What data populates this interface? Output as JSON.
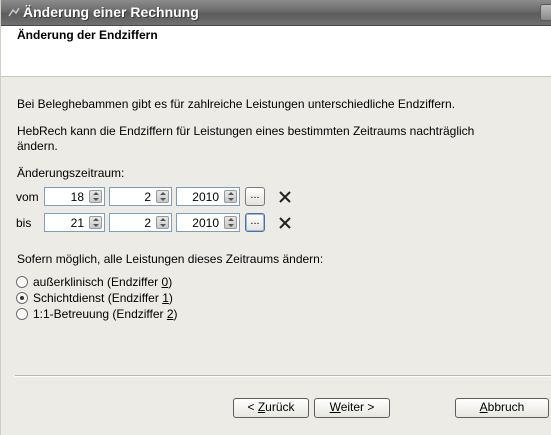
{
  "window": {
    "title": "Änderung einer Rechnung"
  },
  "header": {
    "title": "Änderung der Endziffern"
  },
  "main": {
    "intro_line1": "Bei Beleghebammen gibt es für zahlreiche Leistungen unterschiedliche Endziffern.",
    "intro_line2a": "HebRech kann die Endziffern für Leistungen eines bestimmten Zeitraums nachträglich",
    "intro_line2b": "ändern.",
    "period_label": "Änderungszeitraum:",
    "from": {
      "label": "vom",
      "day": "18",
      "month": "2",
      "year": "2010",
      "picker_label": "..."
    },
    "to": {
      "label": "bis",
      "day": "21",
      "month": "2",
      "year": "2010",
      "picker_label": "..."
    },
    "options_label": "Sofern möglich, alle Leistungen dieses Zeitraums ändern:",
    "options": [
      {
        "text": "außerklinisch (Endziffer ",
        "digit": "0",
        "end": ")",
        "selected": false
      },
      {
        "text": "Schichtdienst (Endziffer ",
        "digit": "1",
        "end": ")",
        "selected": true
      },
      {
        "text": "1:1-Betreuung (Endziffer ",
        "digit": "2",
        "end": ")",
        "selected": false
      }
    ]
  },
  "footer": {
    "back": {
      "prefix": "< ",
      "mnemonic": "Z",
      "rest": "urück"
    },
    "next": {
      "mnemonic": "W",
      "rest": "eiter >"
    },
    "cancel": {
      "mnemonic": "A",
      "rest": "bbruch"
    }
  },
  "icons": {
    "window": "window-app-icon",
    "clear": "clear-x-icon",
    "spin": "spin-arrows-icon"
  },
  "colors": {
    "titlebar": "#6a6a6a",
    "dialog_bg": "#ecebe6",
    "header_bg": "#ffffff",
    "field_border": "#7f9db9"
  }
}
